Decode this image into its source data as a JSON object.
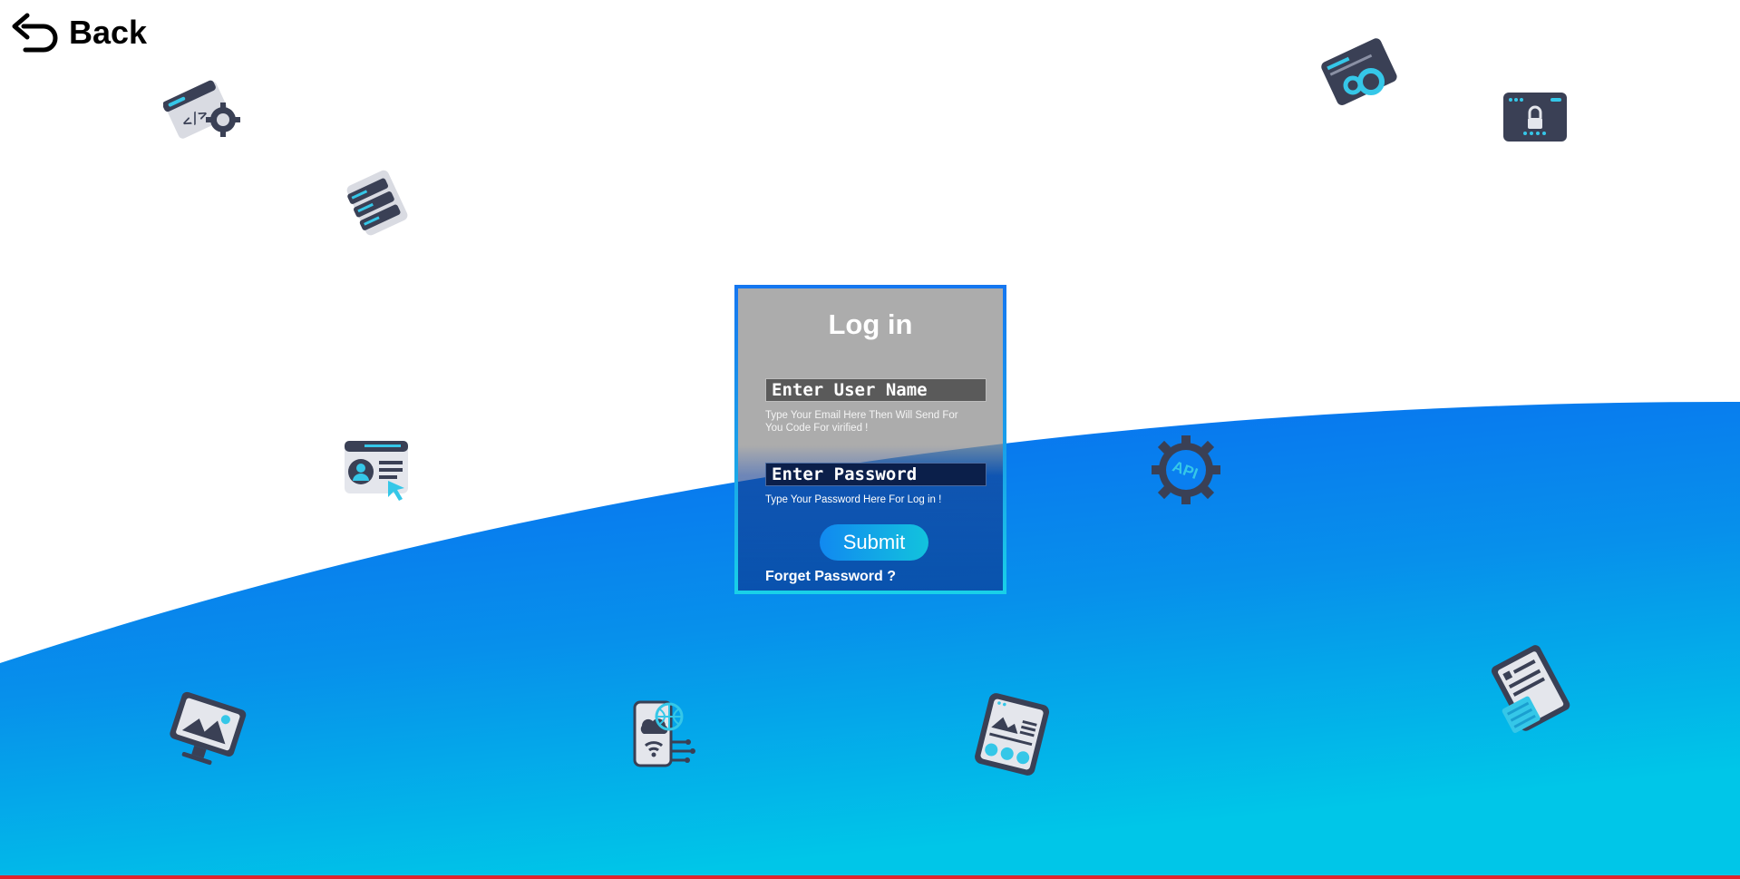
{
  "nav": {
    "back_label": "Back",
    "back_icon": "back-arrow-icon"
  },
  "login": {
    "title": "Log in",
    "username_placeholder": "Enter User Name",
    "username_value": "",
    "username_hint": "Type Your Email Here Then Will Send For You Code For virified !",
    "password_placeholder": "Enter Password",
    "password_value": "",
    "password_hint": "Type Your Password Here For Log in !",
    "submit_label": "Submit",
    "forget_label": "Forget Password ?"
  },
  "decor_icons": [
    "code-settings-icon",
    "server-stack-icon",
    "user-profile-click-icon",
    "web-settings-icon",
    "locked-browser-icon",
    "api-gear-icon",
    "design-monitor-icon",
    "mobile-cloud-icon",
    "web-layout-icon",
    "data-sheet-icon"
  ],
  "colors": {
    "wave_top": "#0a6ef5",
    "wave_bottom": "#00c3e8",
    "accent": "#1aa6e8",
    "icon_dark": "#3a4055",
    "icon_cyan": "#35c7e8",
    "bottom_line": "#e1242d"
  }
}
